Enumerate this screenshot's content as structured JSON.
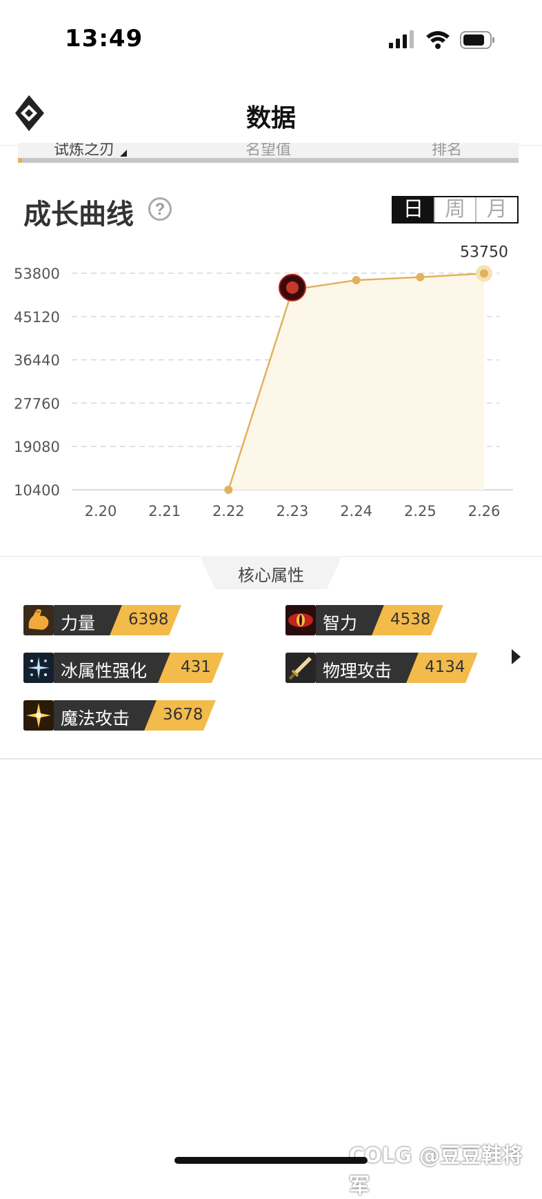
{
  "status_bar": {
    "time": "13:49"
  },
  "header": {
    "title": "数据",
    "logo_icon": "diamond-logo-icon"
  },
  "subtabs": [
    {
      "label": "试炼之刃",
      "active": true
    },
    {
      "label": "名望值",
      "active": false
    },
    {
      "label": "排名",
      "active": false
    }
  ],
  "growth": {
    "title": "成长曲线",
    "help_glyph": "?",
    "periods": [
      {
        "label": "日",
        "active": true
      },
      {
        "label": "周",
        "active": false
      },
      {
        "label": "月",
        "active": false
      }
    ]
  },
  "chart_data": {
    "type": "line",
    "x": [
      "2.20",
      "2.21",
      "2.22",
      "2.23",
      "2.24",
      "2.25",
      "2.26"
    ],
    "series": [
      {
        "values": [
          null,
          null,
          10400,
          50500,
          52400,
          53000,
          53750
        ]
      }
    ],
    "yticks": [
      53800,
      45120,
      36440,
      27760,
      19080,
      10400
    ],
    "ylim": [
      10400,
      53800
    ],
    "last_value_label": "53750",
    "grid": true,
    "line_color": "#dfb25e",
    "fill_color": "#fdf7ea"
  },
  "core": {
    "tab_label": "核心属性",
    "attributes": [
      {
        "label": "力量",
        "value": "6398",
        "icon": "flexed-arm-icon"
      },
      {
        "label": "智力",
        "value": "4538",
        "icon": "red-eye-icon"
      },
      {
        "label": "冰属性强化",
        "value": "431",
        "icon": "ice-sparkle-icon"
      },
      {
        "label": "物理攻击",
        "value": "4134",
        "icon": "sword-icon"
      },
      {
        "label": "魔法攻击",
        "value": "3678",
        "icon": "magic-spark-icon"
      }
    ]
  },
  "watermark": "COLG @豆豆鞋将军",
  "colors": {
    "accent": "#f3bb4a",
    "dark": "#333333",
    "line": "#dfb25e"
  }
}
